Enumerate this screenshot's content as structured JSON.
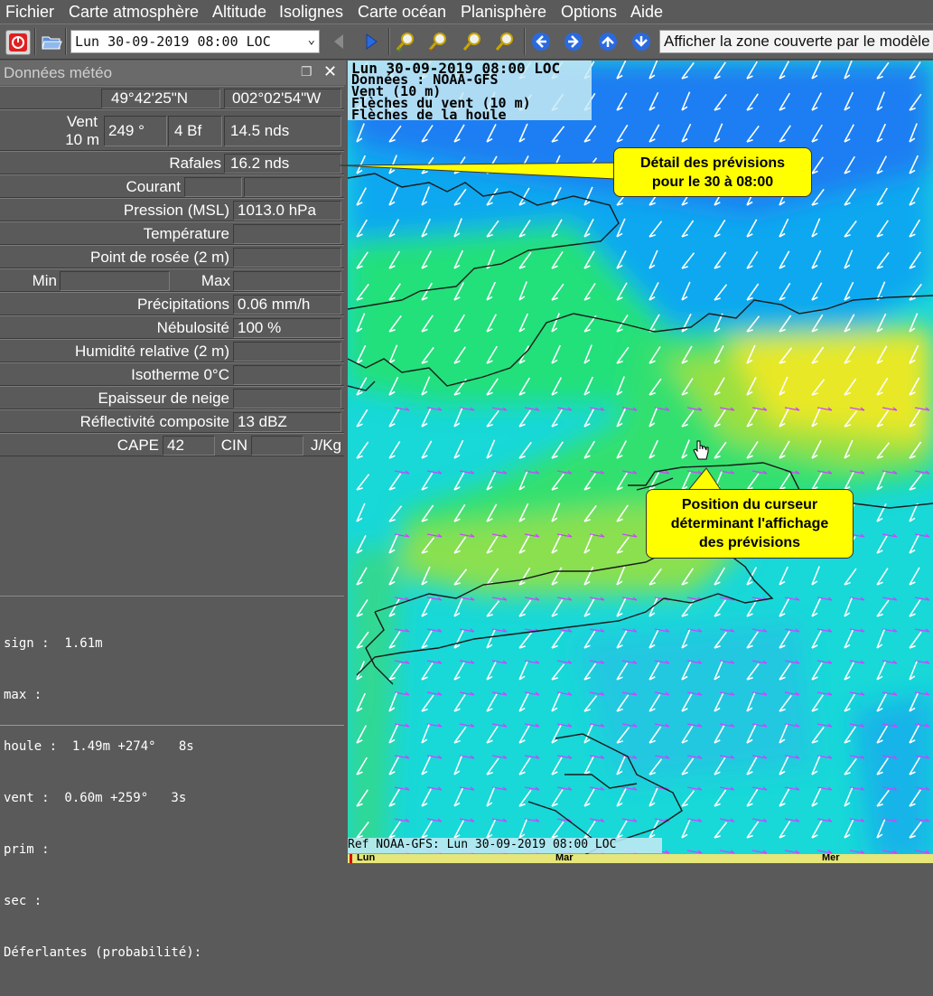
{
  "menu": [
    "Fichier",
    "Carte atmosphère",
    "Altitude",
    "Isolignes",
    "Carte océan",
    "Planisphère",
    "Options",
    "Aide"
  ],
  "toolbar": {
    "date": "Lun 30-09-2019 08:00 LOC",
    "zone_button": "Afficher la zone couverte par le modèle"
  },
  "panel": {
    "title": "Données météo",
    "lat": "49°42'25\"N",
    "lon": "002°02'54\"W",
    "vent_label": "Vent",
    "vent_sub": "10 m",
    "wind_dir": "249 °",
    "wind_bf": "4 Bf",
    "wind_speed": "14.5  nds",
    "rafales_label": "Rafales",
    "rafales": "16.2  nds",
    "courant_label": "Courant",
    "pression_label": "Pression (MSL)",
    "pression": "1013.0 hPa",
    "temperature_label": "Température",
    "rosee_label": "Point de rosée (2 m)",
    "min_label": "Min",
    "max_label": "Max",
    "precip_label": "Précipitations",
    "precip": "0.06 mm/h",
    "nebul_label": "Nébulosité",
    "nebul": "100 %",
    "humid_label": "Humidité relative (2 m)",
    "iso_label": "Isotherme 0°C",
    "neige_label": "Epaisseur de neige",
    "reflect_label": "Réflectivité composite",
    "reflect": "13 dBZ",
    "cape_label": "CAPE",
    "cape": "42",
    "cin_label": "CIN",
    "unit_label": "J/Kg"
  },
  "waves": {
    "line1": "sign :  1.61m",
    "line2": "max :",
    "line3": "houle :  1.49m +274°   8s",
    "line4": "vent :  0.60m +259°   3s",
    "line5": "prim :",
    "line6": "sec :",
    "line7": "Déferlantes (probabilité):"
  },
  "map_header": {
    "line1": "Lun 30-09-2019 08:00 LOC",
    "line2": "Données : NOAA-GFS",
    "line3": "Vent (10 m)",
    "line4": "Flèches du vent (10 m)",
    "line5": "Flèches de la houle"
  },
  "callouts": {
    "detail_line1": "Détail des prévisions",
    "detail_line2": "pour le 30 à 08:00",
    "cursor_line1": "Position du curseur",
    "cursor_line2": "déterminant l'affichage",
    "cursor_line3": "des prévisions"
  },
  "ref": "Ref NOAA-GFS: Lun 30-09-2019 08:00 LOC",
  "timeline": [
    "Lun",
    "Mar",
    "Mer"
  ],
  "colors": {
    "callout": "#ffff00",
    "wind_arrow": "#ffffff",
    "swell_arrow": "#cc44ff",
    "coast": "#1a1a1a"
  }
}
